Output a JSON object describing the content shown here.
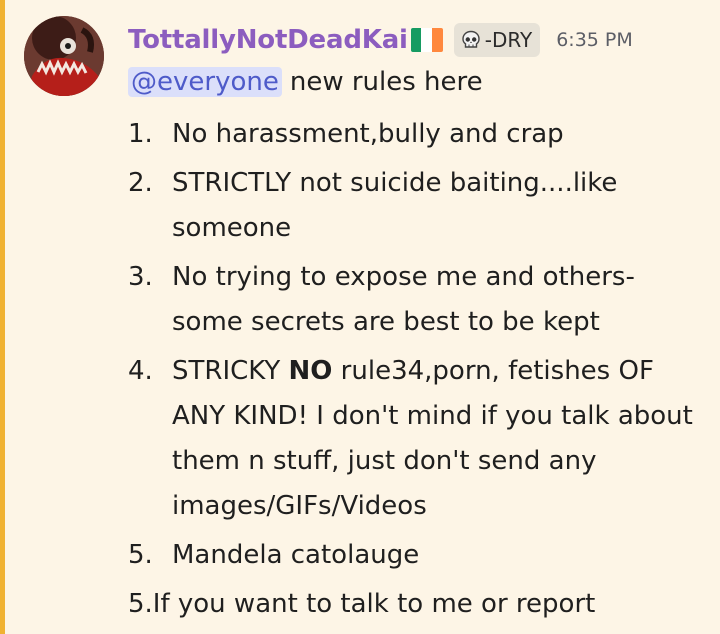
{
  "message": {
    "author": {
      "name": "TottallyNotDeadKai",
      "flag_emoji": "ireland-flag",
      "role_tag": {
        "icon": "skull-icon",
        "label": "-DRY"
      },
      "name_color": "#8c5dbf"
    },
    "timestamp": "6:35 PM",
    "mention": "@everyone",
    "intro_text": "new rules here",
    "rules": [
      {
        "num": "1.",
        "text": "No harassment,bully and crap"
      },
      {
        "num": "2.",
        "text": "STRICTLY not suicide baiting....like someone"
      },
      {
        "num": "3.",
        "text": "No trying to expose me and others- some secrets are best to be kept"
      },
      {
        "num": "4.",
        "prefix": "STRICKY ",
        "bold": "NO",
        "suffix": " rule34,porn, fetishes OF ANY KIND! I don't mind if you talk about them n stuff, just don't send any images/GIFs/Videos"
      },
      {
        "num": "5.",
        "text": "Mandela catolauge"
      }
    ],
    "trailing_line": "5.If you want to talk to me or report"
  },
  "colors": {
    "background": "#fdf5e6",
    "mention_bar": "#f0b232",
    "mention_bg": "#dbdffa",
    "mention_text": "#4e5bc9"
  }
}
